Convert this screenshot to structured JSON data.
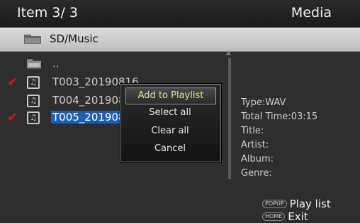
{
  "header": {
    "title": "Item 3/ 3",
    "section": "Media"
  },
  "path": {
    "label": "SD/Music",
    "icon": "folder-icon"
  },
  "files": [
    {
      "name": "..",
      "icon": "folder-up-icon",
      "checked": false,
      "selected": false
    },
    {
      "name": "T003_20190816",
      "icon": "music-note-icon",
      "checked": true,
      "selected": false
    },
    {
      "name": "T004_20190816",
      "icon": "music-note-icon",
      "checked": false,
      "selected": false
    },
    {
      "name": "T005_20190816",
      "icon": "music-note-icon",
      "checked": true,
      "selected": true
    }
  ],
  "popup": {
    "items": [
      "Add to Playlist",
      "Select all",
      "Clear all",
      "Cancel"
    ]
  },
  "details": {
    "type": "Type:WAV",
    "total_time": "Total Time:03:15",
    "title": "Title:",
    "artist": "Artist:",
    "album": "Album:",
    "genre": "Genre:"
  },
  "hints": [
    {
      "key": "POPUP",
      "label": "Play list"
    },
    {
      "key": "HOME",
      "label": "Exit"
    }
  ],
  "colors": {
    "selection": "#1d5fb0",
    "check": "#d01818",
    "popup_highlight": "#e3e0a0"
  }
}
